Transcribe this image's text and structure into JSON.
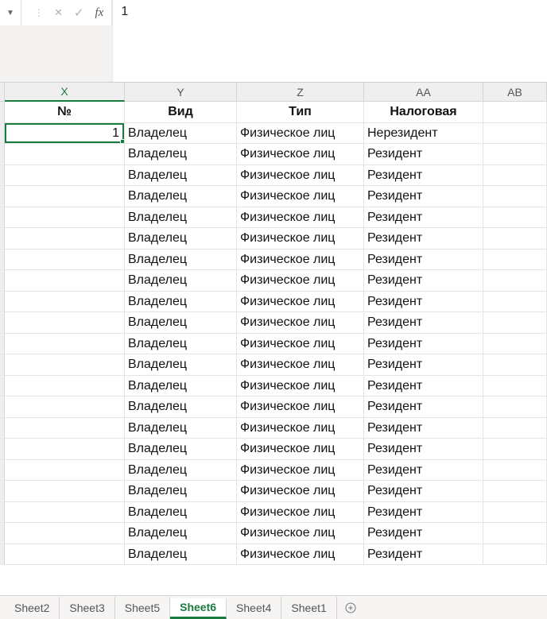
{
  "formula_bar": {
    "name_box_value": "",
    "formula_value": "1",
    "fx_label": "fx"
  },
  "columns": [
    {
      "label": "X",
      "active": true
    },
    {
      "label": "Y",
      "active": false
    },
    {
      "label": "Z",
      "active": false
    },
    {
      "label": "AA",
      "active": false
    },
    {
      "label": "AB",
      "active": false
    }
  ],
  "header_row": [
    "№",
    "Вид",
    "Тип",
    "Налоговая",
    ""
  ],
  "data_rows": [
    {
      "num": "1",
      "vid": "Владелец",
      "tip": "Физическое лиц",
      "nal": "Нерезидент",
      "selected": true
    },
    {
      "num": "",
      "vid": "Владелец",
      "tip": "Физическое лиц",
      "nal": "Резидент"
    },
    {
      "num": "",
      "vid": "Владелец",
      "tip": "Физическое лиц",
      "nal": "Резидент"
    },
    {
      "num": "",
      "vid": "Владелец",
      "tip": "Физическое лиц",
      "nal": "Резидент"
    },
    {
      "num": "",
      "vid": "Владелец",
      "tip": "Физическое лиц",
      "nal": "Резидент"
    },
    {
      "num": "",
      "vid": "Владелец",
      "tip": "Физическое лиц",
      "nal": "Резидент"
    },
    {
      "num": "",
      "vid": "Владелец",
      "tip": "Физическое лиц",
      "nal": "Резидент"
    },
    {
      "num": "",
      "vid": "Владелец",
      "tip": "Физическое лиц",
      "nal": "Резидент"
    },
    {
      "num": "",
      "vid": "Владелец",
      "tip": "Физическое лиц",
      "nal": "Резидент"
    },
    {
      "num": "",
      "vid": "Владелец",
      "tip": "Физическое лиц",
      "nal": "Резидент"
    },
    {
      "num": "",
      "vid": "Владелец",
      "tip": "Физическое лиц",
      "nal": "Резидент"
    },
    {
      "num": "",
      "vid": "Владелец",
      "tip": "Физическое лиц",
      "nal": "Резидент"
    },
    {
      "num": "",
      "vid": "Владелец",
      "tip": "Физическое лиц",
      "nal": "Резидент"
    },
    {
      "num": "",
      "vid": "Владелец",
      "tip": "Физическое лиц",
      "nal": "Резидент"
    },
    {
      "num": "",
      "vid": "Владелец",
      "tip": "Физическое лиц",
      "nal": "Резидент"
    },
    {
      "num": "",
      "vid": "Владелец",
      "tip": "Физическое лиц",
      "nal": "Резидент"
    },
    {
      "num": "",
      "vid": "Владелец",
      "tip": "Физическое лиц",
      "nal": "Резидент"
    },
    {
      "num": "",
      "vid": "Владелец",
      "tip": "Физическое лиц",
      "nal": "Резидент"
    },
    {
      "num": "",
      "vid": "Владелец",
      "tip": "Физическое лиц",
      "nal": "Резидент"
    },
    {
      "num": "",
      "vid": "Владелец",
      "tip": "Физическое лиц",
      "nal": "Резидент"
    },
    {
      "num": "",
      "vid": "Владелец",
      "tip": "Физическое лиц",
      "nal": "Резидент"
    }
  ],
  "sheet_tabs": [
    {
      "label": "Sheet2",
      "active": false
    },
    {
      "label": "Sheet3",
      "active": false
    },
    {
      "label": "Sheet5",
      "active": false
    },
    {
      "label": "Sheet6",
      "active": true
    },
    {
      "label": "Sheet4",
      "active": false
    },
    {
      "label": "Sheet1",
      "active": false
    }
  ]
}
